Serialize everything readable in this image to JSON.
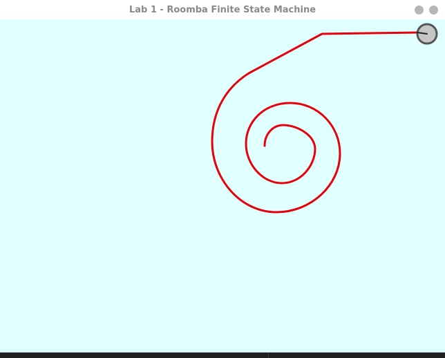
{
  "window": {
    "title": "Lab 1 - Roomba Finite State Machine"
  },
  "colors": {
    "canvas_background": "#e0ffff",
    "path": "#e8000b",
    "robot_fill": "#c6c6c6",
    "robot_outline": "#555555",
    "title_text": "#8a8a8a",
    "window_button": "#b6b6b6"
  },
  "icons": {
    "minimize": "minimize-icon",
    "close": "close-icon",
    "robot": "roomba-robot-icon"
  }
}
